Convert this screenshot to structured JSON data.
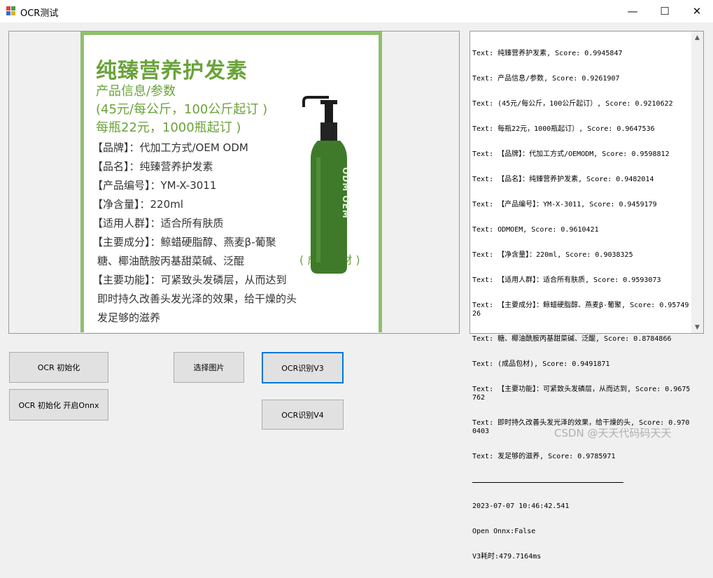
{
  "window": {
    "title": "OCR测试",
    "minimize_glyph": "—",
    "maximize_glyph": "☐",
    "close_glyph": "✕"
  },
  "product_image": {
    "title": "纯臻营养护发素",
    "subtitle": "产品信息/参数",
    "price_line1": "(45元/每公斤，100公斤起订 )",
    "price_line2": "每瓶22元，1000瓶起订 )",
    "brand": "【品牌】：代加工方式/OEM ODM",
    "name": "【品名】：纯臻营养护发素",
    "code": "【产品编号】：YM-X-3011",
    "volume": "【净含量】：220ml",
    "audience": "【适用人群】：适合所有肤质",
    "ingredients_1": "【主要成分】：鲸蜡硬脂醇、燕麦β-葡聚",
    "ingredients_2": "糖、椰油酰胺丙基甜菜碱、泛醌",
    "function_1": "【主要功能】：可紧致头发磷层，从而达到",
    "function_2": "即时持久改善头发光泽的效果，给干燥的头",
    "function_3": "发足够的滋养",
    "caption": "( 成品包材 )",
    "bottle_label": "ODM OEM",
    "accent_color": "#6aa33a"
  },
  "log": {
    "lines": [
      "Text: 纯臻营养护发素, Score: 0.9945847",
      "Text: 产品信息/参数, Score: 0.9261907",
      "Text: (45元/每公斤，100公斤起订）, Score: 0.9210622",
      "Text: 每瓶22元，1000瓶起订）, Score: 0.9647536",
      "Text: 【品牌】：代加工方式/OEMODM, Score: 0.9598812",
      "Text: 【品名】：纯臻营养护发素, Score: 0.9482014",
      "Text: 【产品编号】：YM-X-3011, Score: 0.9459179",
      "Text: ODMOEM, Score: 0.9610421",
      "Text: 【净含量】：220ml, Score: 0.9038325",
      "Text: 【适用人群】：适合所有肤质, Score: 0.9593073",
      "Text: 【主要成分】：鲸蜡硬脂醇、燕麦β-葡聚, Score: 0.9574926",
      "Text: 糖、椰油酰胺丙基甜菜碱、泛醌, Score: 0.8784866",
      "Text: (成品包材), Score: 0.9491871",
      "Text: 【主要功能】：可紧致头发磷层，从而达到, Score: 0.9675762",
      "Text: 即时持久改善头发光泽的效果，给干燥的头, Score: 0.9700403",
      "Text: 发足够的滋养, Score: 0.9785971"
    ],
    "timestamp": "2023-07-07 10:46:42.541",
    "onnx_status": "Open Onnx:False",
    "timing": "V3耗时:479.7164ms",
    "scroll_up_glyph": "▲",
    "scroll_down_glyph": "▼"
  },
  "buttons": {
    "ocr_init": "OCR 初始化",
    "ocr_init_onnx": "OCR 初始化 开启Onnx",
    "select_image": "选择图片",
    "ocr_v3": "OCR识别V3",
    "ocr_v4": "OCR识别V4"
  },
  "watermark": "CSDN @天天代码码天天"
}
